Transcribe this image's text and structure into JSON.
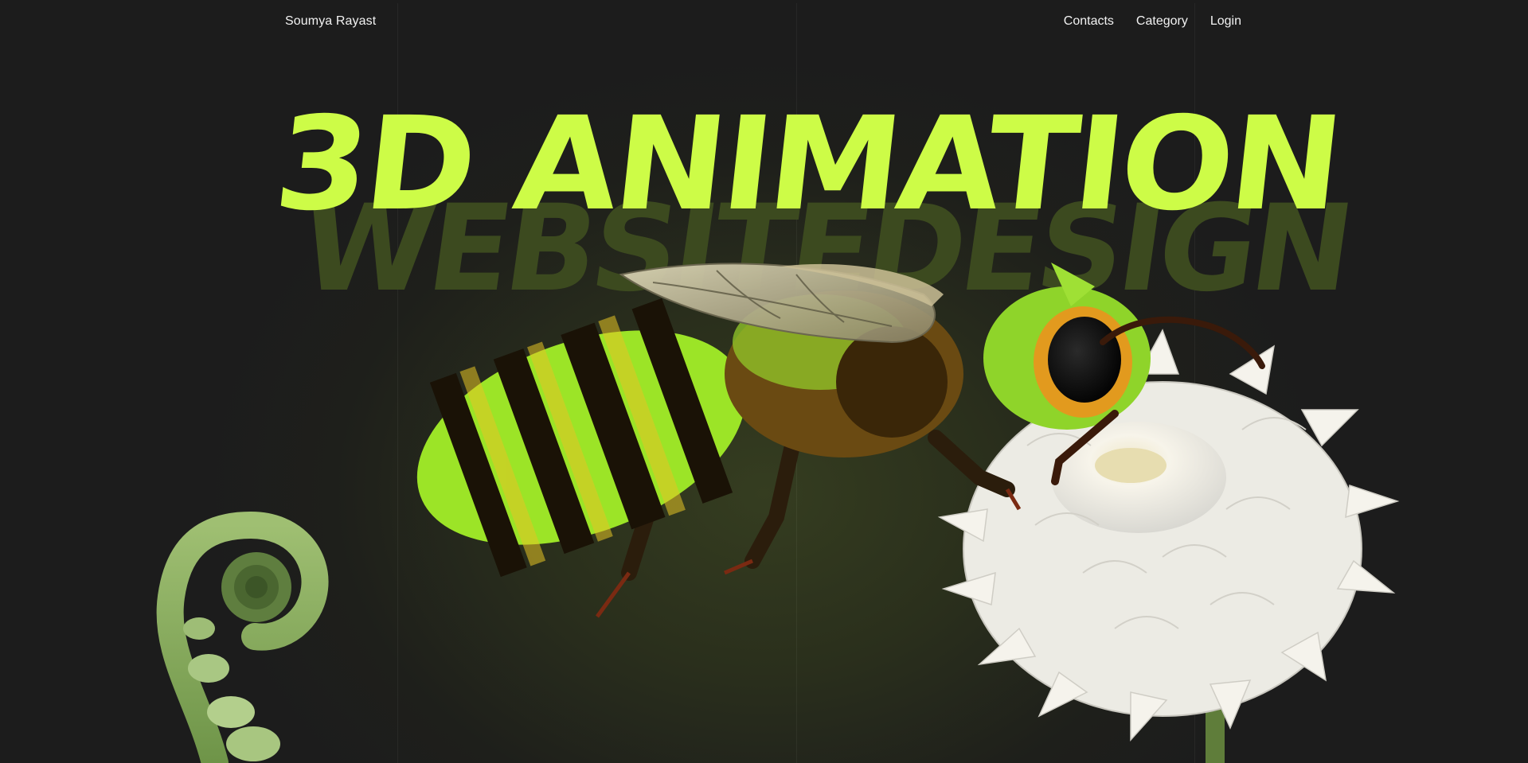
{
  "header": {
    "brand": "Soumya Rayast",
    "nav": [
      {
        "label": "Contacts"
      },
      {
        "label": "Category"
      },
      {
        "label": "Login"
      }
    ]
  },
  "hero": {
    "title": "3D ANIMATION",
    "subtitle": "WEBSITEDESIGN"
  },
  "colors": {
    "accent": "#cdfc47",
    "subtitle": "#3c4a1f",
    "background": "#1c1c1c"
  },
  "illustrations": [
    "fern-fiddlehead",
    "bee",
    "white-dahlia-flower"
  ]
}
